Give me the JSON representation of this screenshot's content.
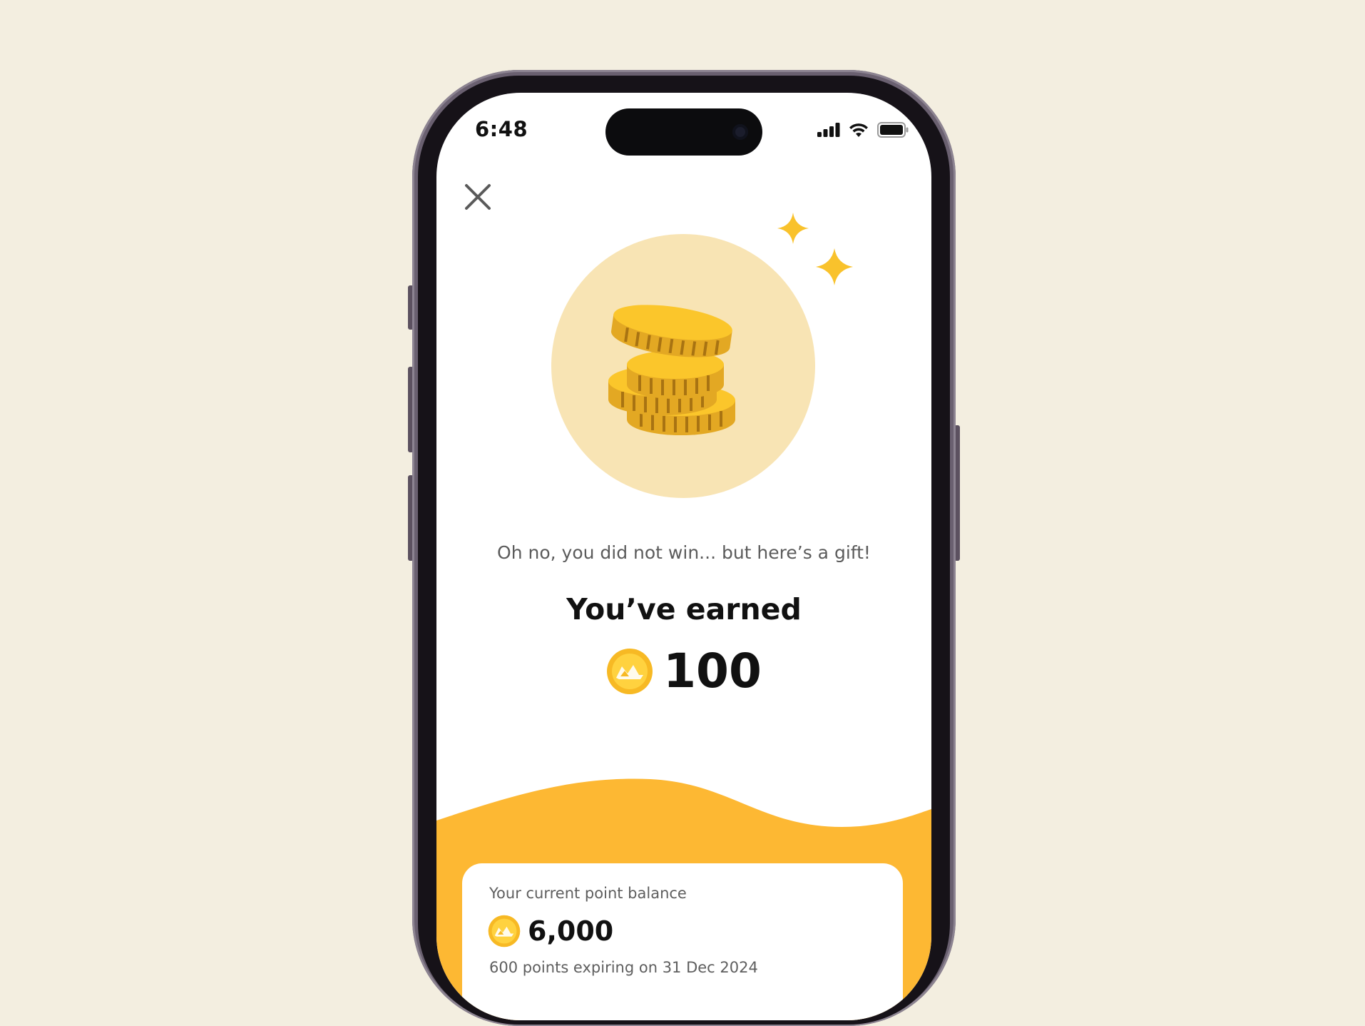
{
  "status_bar": {
    "time": "6:48"
  },
  "reward": {
    "subtitle": "Oh no, you did not win... but here’s a gift!",
    "headline": "You’ve earned",
    "amount": "100"
  },
  "balance": {
    "label": "Your current point balance",
    "amount": "6,000",
    "expiry": "600 points expiring on 31 Dec 2024"
  },
  "colors": {
    "background": "#f3eee0",
    "accent_orange": "#fdb833",
    "coin_gold": "#f8c51e",
    "hero_circle": "#f8e4b4"
  },
  "icons": [
    "close-icon",
    "signal-icon",
    "wifi-icon",
    "battery-icon",
    "coins-illustration",
    "sparkle-icon",
    "point-coin-icon"
  ]
}
